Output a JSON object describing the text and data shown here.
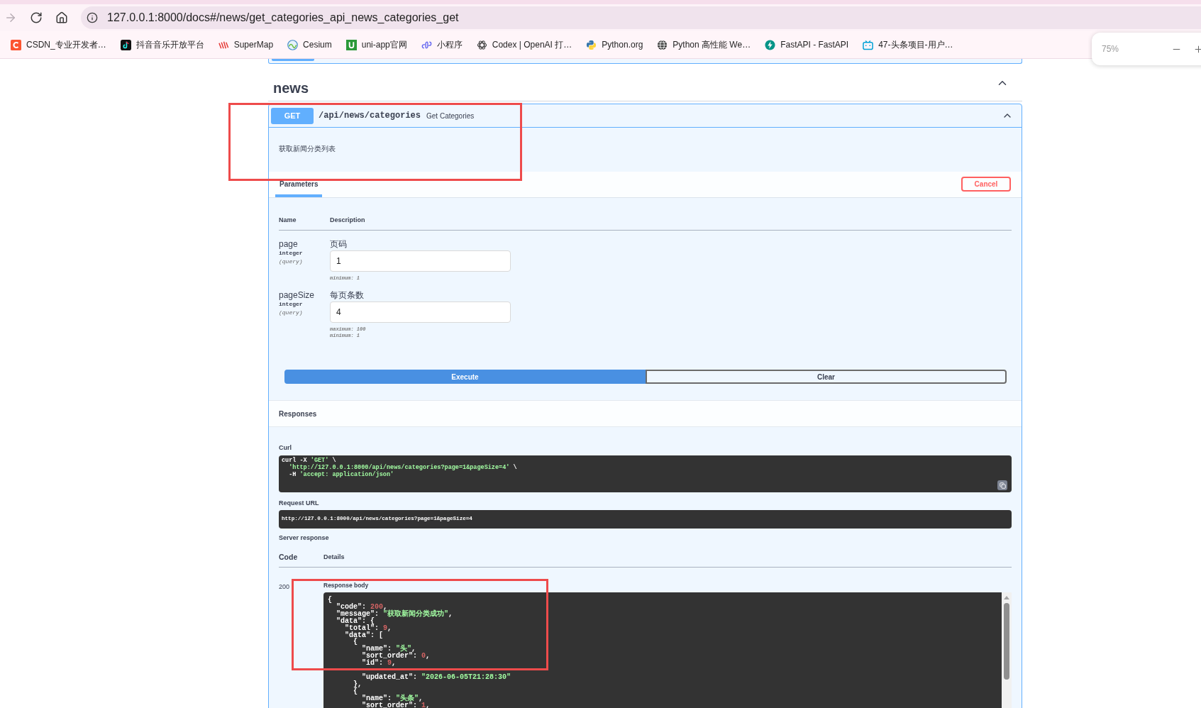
{
  "browser": {
    "nav_buttons": [
      {
        "kind": "forward",
        "disabled": true
      },
      {
        "kind": "reload",
        "disabled": false
      },
      {
        "kind": "home",
        "disabled": false
      }
    ],
    "address": "127.0.0.1:8000/docs#/news/get_categories_api_news_categories_get",
    "bookmarks": [
      "CSDN_专业开发者…",
      "抖音音乐开放平台",
      "SuperMap",
      "Cesium",
      "uni-app官网",
      "小程序",
      "Codex | OpenAI 打…",
      "Python.org",
      "Python 高性能 We…",
      "FastAPI - FastAPI",
      "47-头条项目-用户…"
    ],
    "zoom_popup": {
      "level_text": "75%"
    }
  },
  "section": {
    "title": "news",
    "expanded": true,
    "operation": {
      "method": "GET",
      "path": "/api/news/categories",
      "summary": "Get Categories",
      "expanded": true,
      "description": "获取新闻分类列表",
      "tabs": [
        {
          "label": "Parameters",
          "selected": true
        }
      ],
      "cancel_button": "Cancel",
      "param_columns": [
        "Name",
        "Description"
      ],
      "params": [
        {
          "name": "page",
          "type": "integer",
          "location": "(query)",
          "description": "页码",
          "value": "1",
          "constraints": [
            "minimum: 1"
          ]
        },
        {
          "name": "pageSize",
          "type": "integer",
          "location": "(query)",
          "description": "每页条数",
          "value": "4",
          "constraints": [
            "maximum: 100",
            "minimum: 1"
          ]
        }
      ],
      "buttons": [
        {
          "label": "Execute",
          "kind": "primary"
        },
        {
          "label": "Clear",
          "kind": "secondary"
        }
      ],
      "responses": {
        "title": "Responses",
        "curl_label": "Curl",
        "curl_lines": [
          [
            {
              "kind": "plain",
              "text": "curl -X "
            },
            {
              "kind": "string",
              "text": "'GET'"
            },
            {
              "kind": "plain",
              "text": " \\"
            }
          ],
          [
            {
              "kind": "string",
              "text": "  'http://127.0.0.1:8000/api/news/categories?page=1&pageSize=4'"
            },
            {
              "kind": "plain",
              "text": " \\"
            }
          ],
          [
            {
              "kind": "plain",
              "text": "  -H "
            },
            {
              "kind": "string",
              "text": "'accept: application/json'"
            }
          ]
        ],
        "request_url_label": "Request URL",
        "request_url": "http://127.0.0.1:8000/api/news/categories?page=1&pageSize=4",
        "server_response_label": "Server response",
        "columns": [
          "Code",
          "Details"
        ],
        "code": "200",
        "body_label": "Response body",
        "body_lines": [
          [
            {
              "kind": "plain",
              "text": "{"
            }
          ],
          [
            {
              "kind": "plain",
              "text": "  \"code\": "
            },
            {
              "kind": "number",
              "text": "200"
            },
            {
              "kind": "plain",
              "text": ","
            }
          ],
          [
            {
              "kind": "plain",
              "text": "  \"message\": "
            },
            {
              "kind": "string",
              "text": "\"获取新闻分类成功\""
            },
            {
              "kind": "plain",
              "text": ","
            }
          ],
          [
            {
              "kind": "plain",
              "text": "  \"data\": {"
            }
          ],
          [
            {
              "kind": "plain",
              "text": "    \"total\": "
            },
            {
              "kind": "number",
              "text": "9"
            },
            {
              "kind": "plain",
              "text": ","
            }
          ],
          [
            {
              "kind": "plain",
              "text": "    \"data\": ["
            }
          ],
          [
            {
              "kind": "plain",
              "text": "      {"
            }
          ],
          [
            {
              "kind": "plain",
              "text": "        \"name\": "
            },
            {
              "kind": "string",
              "text": "\"头\""
            },
            {
              "kind": "plain",
              "text": ","
            }
          ],
          [
            {
              "kind": "plain",
              "text": "        \"sort_order\": "
            },
            {
              "kind": "number",
              "text": "0"
            },
            {
              "kind": "plain",
              "text": ","
            }
          ],
          [
            {
              "kind": "plain",
              "text": "        \"id\": "
            },
            {
              "kind": "number",
              "text": "9"
            },
            {
              "kind": "plain",
              "text": ","
            }
          ]
        ],
        "body_lines_lower": [
          [
            {
              "kind": "plain",
              "text": "        \"updated_at\": "
            },
            {
              "kind": "string",
              "text": "\"2026-06-05T21:28:30\""
            }
          ],
          [
            {
              "kind": "plain",
              "text": "      },"
            }
          ],
          [
            {
              "kind": "plain",
              "text": "      {"
            }
          ],
          [
            {
              "kind": "plain",
              "text": "        \"name\": "
            },
            {
              "kind": "string",
              "text": "\"头条\""
            },
            {
              "kind": "plain",
              "text": ","
            }
          ],
          [
            {
              "kind": "plain",
              "text": "        \"sort_order\": "
            },
            {
              "kind": "number",
              "text": "1"
            },
            {
              "kind": "plain",
              "text": ","
            }
          ]
        ]
      }
    }
  }
}
